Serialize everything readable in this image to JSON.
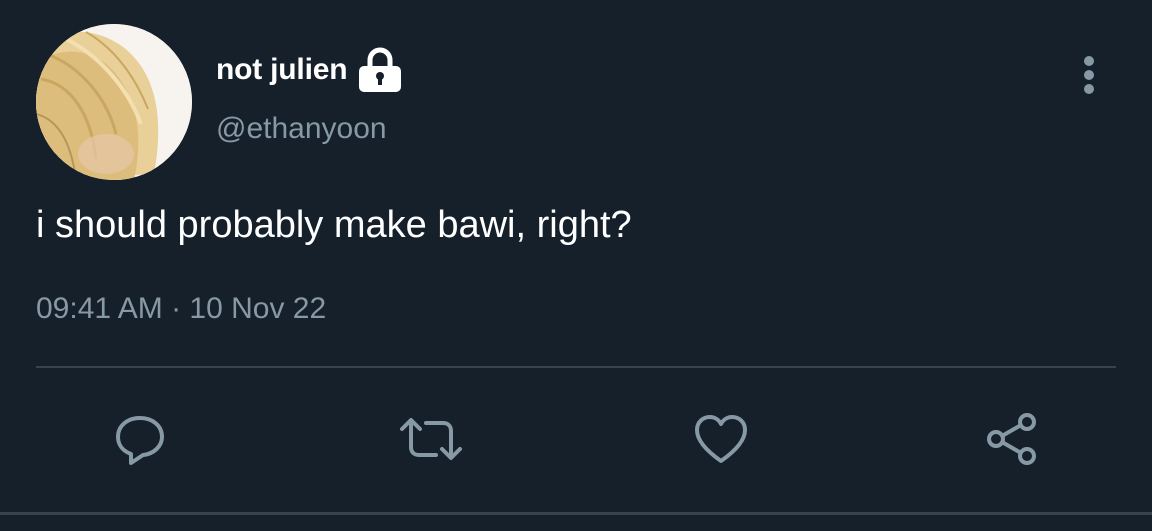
{
  "tweet": {
    "author": {
      "display_name": "not julien",
      "handle": "@ethanyoon",
      "avatar_icon": "avatar-photo",
      "protected_icon": "lock-icon"
    },
    "text": "i should probably make bawi, right?",
    "timestamp": "09:41 AM · 10 Nov 22",
    "more_icon": "more-vertical-icon"
  },
  "actions": [
    {
      "name": "reply",
      "icon": "comment-icon"
    },
    {
      "name": "retweet",
      "icon": "retweet-icon"
    },
    {
      "name": "like",
      "icon": "heart-icon"
    },
    {
      "name": "share",
      "icon": "share-icon"
    }
  ],
  "colors": {
    "background": "#15202b",
    "text_primary": "#ffffff",
    "text_secondary": "#8899a6",
    "icon": "#8899a6",
    "divider": "#38444d"
  }
}
